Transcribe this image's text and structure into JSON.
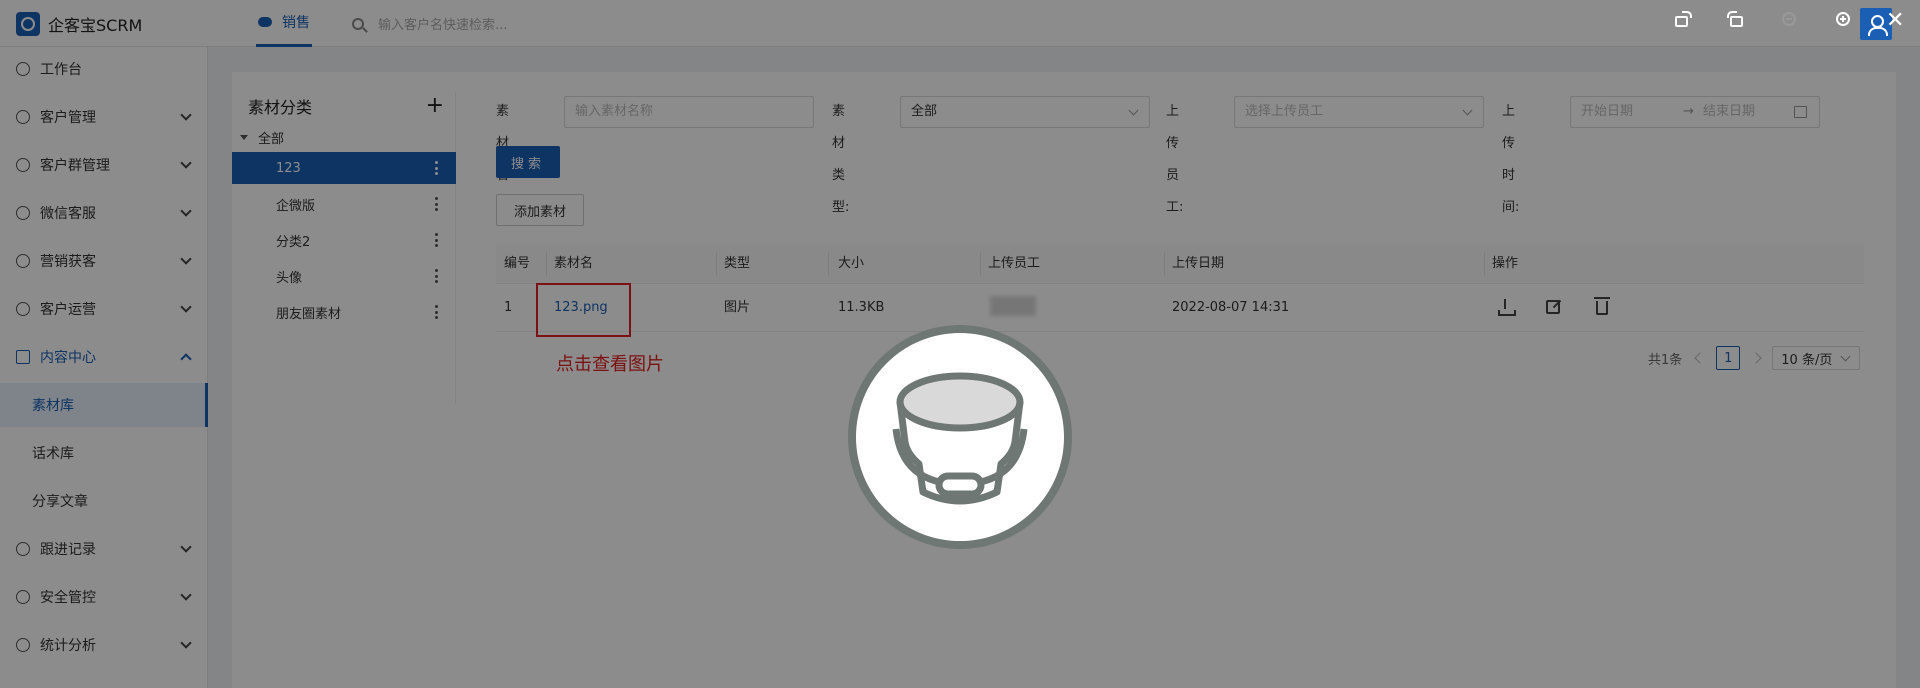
{
  "app": {
    "name": "企客宝SCRM"
  },
  "topnav": {
    "active_tab": "销售",
    "search_placeholder": "输入客户名快速检索..."
  },
  "sidebar": {
    "items": [
      {
        "label": "工作台",
        "icon": "dashboard-icon"
      },
      {
        "label": "客户管理",
        "icon": "customer-icon"
      },
      {
        "label": "客户群管理",
        "icon": "group-icon"
      },
      {
        "label": "微信客服",
        "icon": "wechat-service-icon"
      },
      {
        "label": "营销获客",
        "icon": "marketing-icon"
      },
      {
        "label": "客户运营",
        "icon": "operation-icon"
      },
      {
        "label": "内容中心",
        "icon": "content-icon"
      },
      {
        "label": "素材库"
      },
      {
        "label": "话术库"
      },
      {
        "label": "分享文章"
      },
      {
        "label": "跟进记录",
        "icon": "followup-icon"
      },
      {
        "label": "安全管控",
        "icon": "security-icon"
      },
      {
        "label": "统计分析",
        "icon": "chart-icon"
      }
    ]
  },
  "category_tree": {
    "title": "素材分类",
    "root": "全部",
    "nodes": [
      "123",
      "企微版",
      "分类2",
      "头像",
      "朋友圈素材"
    ],
    "selected": "123"
  },
  "filters": {
    "name_label": "素材名称:",
    "name_placeholder": "输入素材名称",
    "type_label": "素材类型:",
    "type_value": "全部",
    "uploader_label": "上传员工:",
    "uploader_placeholder": "选择上传员工",
    "time_label": "上传时间:",
    "start_placeholder": "开始日期",
    "range_arrow": "→",
    "end_placeholder": "结束日期",
    "search_button": "搜索",
    "add_button": "添加素材"
  },
  "table": {
    "headers": [
      "编号",
      "素材名",
      "类型",
      "大小",
      "上传员工",
      "上传日期",
      "操作"
    ],
    "rows": [
      {
        "id": "1",
        "name": "123.png",
        "type": "图片",
        "size": "11.3KB",
        "uploader": "",
        "date": "2022-08-07 14:31"
      }
    ]
  },
  "annotation": {
    "note": "点击查看图片",
    "color": "#e02020"
  },
  "pagination": {
    "total": "共1条",
    "current": "1",
    "page_size": "10 条/页"
  },
  "viewer": {
    "tools": [
      "rotate-left-icon",
      "rotate-right-icon",
      "zoom-out-icon",
      "zoom-in-icon",
      "close-icon"
    ],
    "close": "✕",
    "image": "bucket-placeholder-icon"
  },
  "colors": {
    "primary": "#1a5fb4",
    "overlay": "rgba(0,0,0,0.45)"
  }
}
